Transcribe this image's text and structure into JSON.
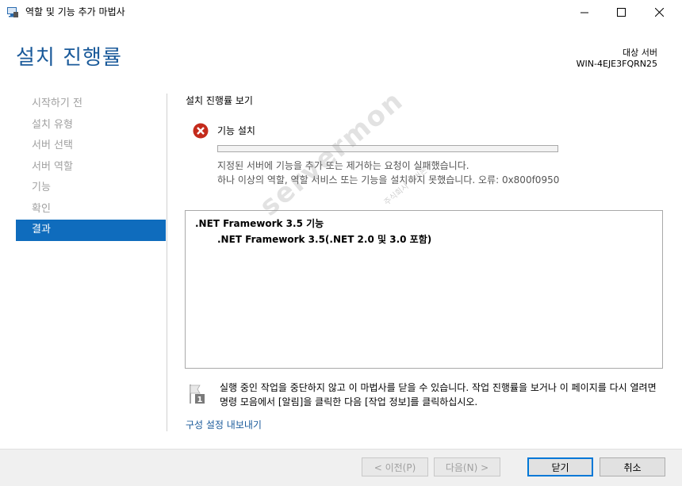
{
  "window": {
    "title": "역할 및 기능 추가 마법사",
    "controls": [
      "minimize",
      "maximize",
      "close"
    ]
  },
  "header": {
    "page_title": "설치 진행률",
    "target_label": "대상 서버",
    "target_name": "WIN-4EJE3FQRN25"
  },
  "nav": {
    "items": [
      {
        "label": "시작하기 전",
        "active": false
      },
      {
        "label": "설치 유형",
        "active": false
      },
      {
        "label": "서버 선택",
        "active": false
      },
      {
        "label": "서버 역할",
        "active": false
      },
      {
        "label": "기능",
        "active": false
      },
      {
        "label": "확인",
        "active": false
      },
      {
        "label": "결과",
        "active": true
      }
    ]
  },
  "main": {
    "section_title": "설치 진행률 보기",
    "status": {
      "icon": "error-icon",
      "name": "기능 설치",
      "progress": 0,
      "message_line1": "지정된 서버에 기능을 추가 또는 제거하는 요청이 실패했습니다.",
      "message_line2": "하나 이상의 역할, 역할 서비스 또는 기능을 설치하지 못했습니다. 오류: 0x800f0950"
    },
    "results": [
      ".NET Framework 3.5 기능",
      ".NET Framework 3.5(.NET 2.0 및 3.0 포함)"
    ],
    "watermark": "servermon",
    "watermark_sub": "주식회사 서버몬",
    "note_icon": "flag-1-icon",
    "note": "실행 중인 작업을 중단하지 않고 이 마법사를 닫을 수 있습니다. 작업 진행률을 보거나 이 페이지를 다시 열려면 명령 모음에서 [알림]을 클릭한 다음 [작업 정보]를 클릭하십시오.",
    "export_link": "구성 설정 내보내기"
  },
  "footer": {
    "prev": "< 이전(P)",
    "next": "다음(N) >",
    "close": "닫기",
    "cancel": "취소"
  },
  "colors": {
    "accent": "#0f6cbd",
    "title": "#1a5a9a",
    "error": "#c42b1c"
  }
}
